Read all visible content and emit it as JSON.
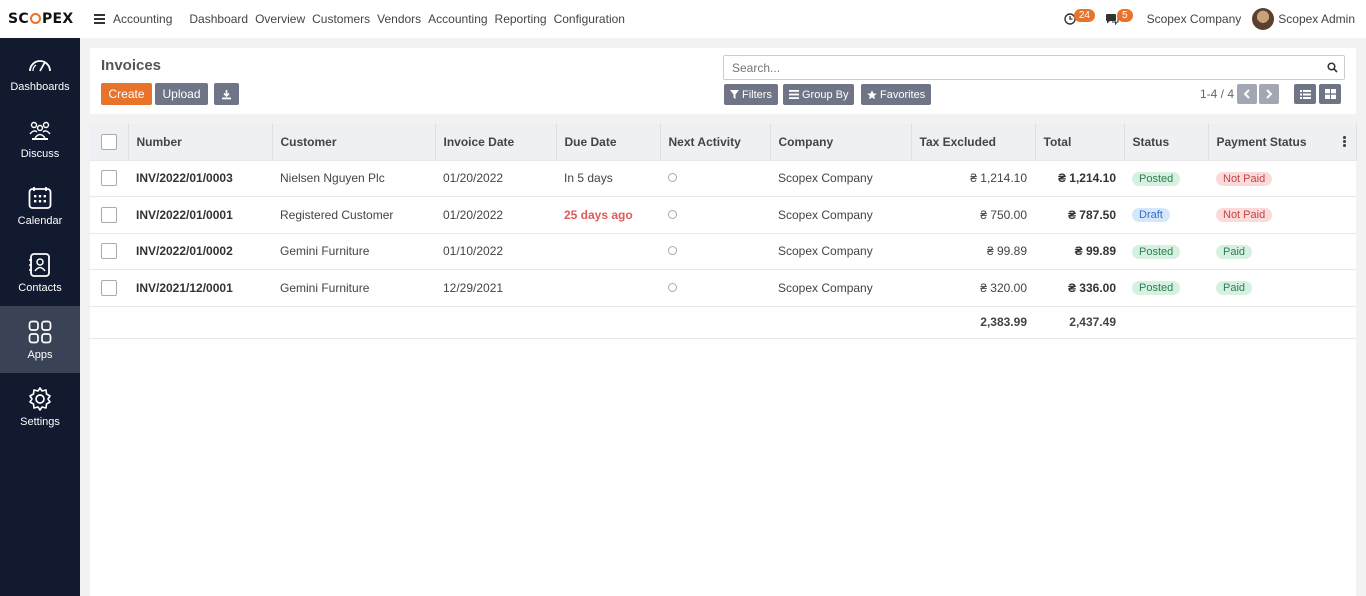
{
  "brand": {
    "logo_pre": "SC",
    "logo_post": "PEX"
  },
  "topbar": {
    "app_name": "Accounting",
    "nav": [
      "Dashboard",
      "Overview",
      "Customers",
      "Vendors",
      "Accounting",
      "Reporting",
      "Configuration"
    ],
    "activity_count": "24",
    "message_count": "5",
    "company": "Scopex Company",
    "user": "Scopex Admin"
  },
  "sidebar": {
    "items": [
      {
        "label": "Dashboards",
        "icon": "gauge-icon"
      },
      {
        "label": "Discuss",
        "icon": "people-icon"
      },
      {
        "label": "Calendar",
        "icon": "calendar-icon"
      },
      {
        "label": "Contacts",
        "icon": "contact-book-icon"
      },
      {
        "label": "Apps",
        "icon": "grid-icon"
      },
      {
        "label": "Settings",
        "icon": "gear-icon"
      }
    ],
    "active": "Apps"
  },
  "control": {
    "title": "Invoices",
    "create_label": "Create",
    "upload_label": "Upload",
    "search_placeholder": "Search...",
    "filters_label": "Filters",
    "groupby_label": "Group By",
    "favorites_label": "Favorites",
    "pager": "1-4 / 4"
  },
  "table": {
    "columns": [
      "Number",
      "Customer",
      "Invoice Date",
      "Due Date",
      "Next Activity",
      "Company",
      "Tax Excluded",
      "Total",
      "Status",
      "Payment Status"
    ],
    "rows": [
      {
        "number": "INV/2022/01/0003",
        "customer": "Nielsen Nguyen Plc",
        "invoice_date": "01/20/2022",
        "due_date": "In 5 days",
        "due_overdue": false,
        "company": "Scopex Company",
        "tax_excluded": "₴ 1,214.10",
        "total": "₴ 1,214.10",
        "status": "Posted",
        "payment_status": "Not Paid"
      },
      {
        "number": "INV/2022/01/0001",
        "customer": "Registered Customer",
        "invoice_date": "01/20/2022",
        "due_date": "25 days ago",
        "due_overdue": true,
        "company": "Scopex Company",
        "tax_excluded": "₴ 750.00",
        "total": "₴ 787.50",
        "status": "Draft",
        "payment_status": "Not Paid"
      },
      {
        "number": "INV/2022/01/0002",
        "customer": "Gemini Furniture",
        "invoice_date": "01/10/2022",
        "due_date": "",
        "due_overdue": false,
        "company": "Scopex Company",
        "tax_excluded": "₴ 99.89",
        "total": "₴ 99.89",
        "status": "Posted",
        "payment_status": "Paid"
      },
      {
        "number": "INV/2021/12/0001",
        "customer": "Gemini Furniture",
        "invoice_date": "12/29/2021",
        "due_date": "",
        "due_overdue": false,
        "company": "Scopex Company",
        "tax_excluded": "₴ 320.00",
        "total": "₴ 336.00",
        "status": "Posted",
        "payment_status": "Paid"
      }
    ],
    "totals": {
      "tax_excluded": "2,383.99",
      "total": "2,437.49"
    }
  },
  "colors": {
    "accent": "#e8732a",
    "sidebar_bg": "#111a2e",
    "button_gray": "#6f7586"
  }
}
